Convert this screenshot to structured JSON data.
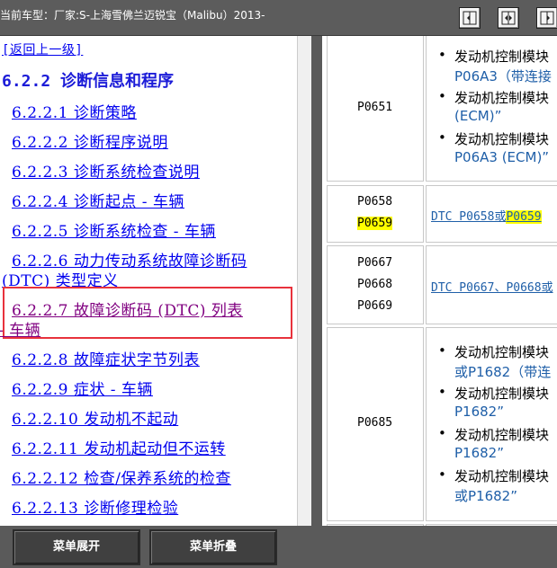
{
  "window": {
    "title": "当前车型：厂家:S-上海雪佛兰迈锐宝（Malibu）2013-"
  },
  "toolbar": {
    "buttons": [
      {
        "icon": "collapse-left-icon"
      },
      {
        "icon": "split-view-icon"
      },
      {
        "icon": "collapse-right-icon"
      }
    ]
  },
  "nav": {
    "back_link": "[返回上一级]",
    "section_heading": "6.2.2 诊断信息和程序",
    "items": [
      {
        "label": "6.2.2.1 诊断策略"
      },
      {
        "label": "6.2.2.2 诊断程序说明"
      },
      {
        "label": "6.2.2.3 诊断系统检查说明"
      },
      {
        "label": "6.2.2.4 诊断起点 - 车辆"
      },
      {
        "label": "6.2.2.5 诊断系统检查 - 车辆"
      },
      {
        "label_line1": "6.2.2.6 动力传动系统故障诊断码",
        "label_line2": "(DTC) 类型定义"
      },
      {
        "label_line1": "6.2.2.7 故障诊断码 (DTC) 列表",
        "label_line2": "- 车辆",
        "active": true
      },
      {
        "label": "6.2.2.8 故障症状字节列表"
      },
      {
        "label": "6.2.2.9 症状 - 车辆"
      },
      {
        "label": "6.2.2.10 发动机不起动"
      },
      {
        "label": "6.2.2.11 发动机起动但不运转"
      },
      {
        "label": "6.2.2.12 检查/保养系统的检查"
      },
      {
        "label": "6.2.2.13 诊断修理检验"
      }
    ]
  },
  "table": {
    "rows": [
      {
        "codes": [
          "P0651"
        ],
        "bullets": [
          {
            "line1": "发动机控制模块",
            "line2": "P06A3（带连接"
          },
          {
            "line1": "发动机控制模块",
            "line2": "(ECM)”"
          },
          {
            "line1": "发动机控制模块",
            "line2": "P06A3 (ECM)”"
          }
        ]
      },
      {
        "codes": [
          "P0658",
          "P0659"
        ],
        "link_prefix": "DTC P0658或",
        "link_highlight": "P0659"
      },
      {
        "codes": [
          "P0667",
          "P0668",
          "P0669"
        ],
        "link": "DTC P0667、P0668或"
      },
      {
        "codes": [
          "P0685"
        ],
        "bullets": [
          {
            "line1": "发动机控制模块",
            "line2": "或P1682（带连"
          },
          {
            "line1": "发动机控制模块",
            "line2": "P1682”"
          },
          {
            "line1": "发动机控制模块",
            "line2": "P1682”"
          },
          {
            "line1": "发动机控制模块",
            "line2": "或P1682”"
          }
        ]
      }
    ]
  },
  "bottom": {
    "expand_label": "菜单展开",
    "collapse_label": "菜单折叠"
  }
}
